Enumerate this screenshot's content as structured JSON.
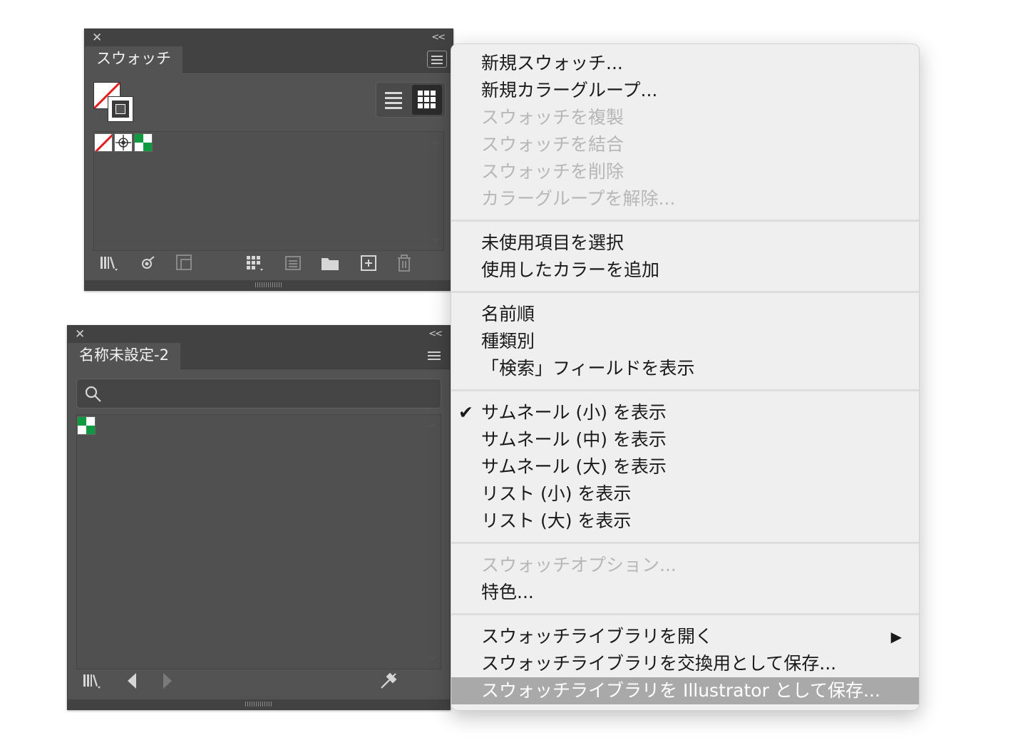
{
  "panel1": {
    "tab_label": "スウォッチ",
    "close_glyph": "✕",
    "collapse_glyph": "<<"
  },
  "panel2": {
    "tab_label": "名称未設定-2",
    "close_glyph": "✕",
    "collapse_glyph": "<<",
    "search": {
      "placeholder": "",
      "value": ""
    }
  },
  "colors": {
    "panel_bg": "#535353",
    "titlebar_bg": "#424242",
    "swatch_green": "#0f9a42",
    "none_red": "#e02020",
    "menu_bg": "#efefef",
    "menu_highlight": "#a9a9a9"
  },
  "menu": {
    "new_swatch": "新規スウォッチ...",
    "new_color_group": "新規カラーグループ...",
    "duplicate_swatch": "スウォッチを複製",
    "merge_swatches": "スウォッチを結合",
    "delete_swatch": "スウォッチを削除",
    "ungroup_color_group": "カラーグループを解除...",
    "select_unused": "未使用項目を選択",
    "add_used_colors": "使用したカラーを追加",
    "sort_by_name": "名前順",
    "sort_by_kind": "種類別",
    "show_find_field": "「検索」フィールドを表示",
    "small_thumbnail": "サムネール (小) を表示",
    "medium_thumbnail": "サムネール (中) を表示",
    "large_thumbnail": "サムネール (大) を表示",
    "small_list": "リスト (小) を表示",
    "large_list": "リスト (大) を表示",
    "swatch_options": "スウォッチオプション...",
    "spot_colors": "特色...",
    "open_swatch_library": "スウォッチライブラリを開く",
    "save_for_exchange": "スウォッチライブラリを交換用として保存...",
    "save_as_illustrator": "スウォッチライブラリを Illustrator として保存...",
    "checkmark": "✔",
    "submenu_arrow": "▶"
  }
}
